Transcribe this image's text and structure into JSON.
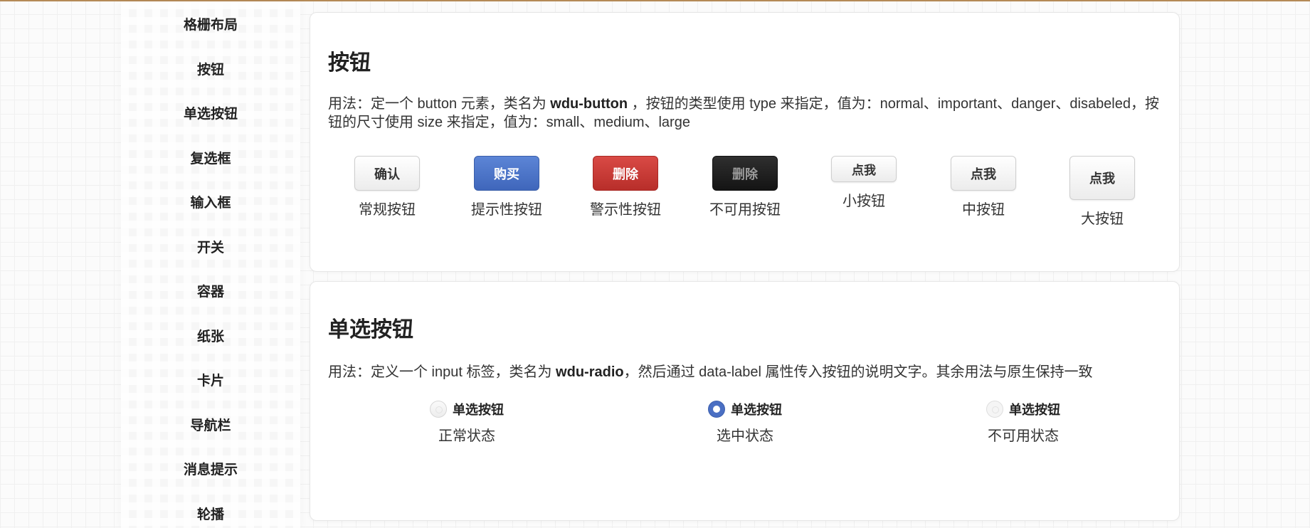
{
  "sidebar": {
    "items": [
      {
        "label": "格栅布局"
      },
      {
        "label": "按钮"
      },
      {
        "label": "单选按钮"
      },
      {
        "label": "复选框"
      },
      {
        "label": "输入框"
      },
      {
        "label": "开关"
      },
      {
        "label": "容器"
      },
      {
        "label": "纸张"
      },
      {
        "label": "卡片"
      },
      {
        "label": "导航栏"
      },
      {
        "label": "消息提示"
      },
      {
        "label": "轮播"
      }
    ]
  },
  "button_section": {
    "title": "按钮",
    "usage_prefix": "用法：定一个 button 元素，类名为 ",
    "usage_class": "wdu-button",
    "usage_suffix": " ，按钮的类型使用 type 来指定，值为：normal、important、danger、disabeled，按钮的尺寸使用 size 来指定，值为：small、medium、large",
    "demos": [
      {
        "button_text": "确认",
        "caption": "常规按钮"
      },
      {
        "button_text": "购买",
        "caption": "提示性按钮"
      },
      {
        "button_text": "删除",
        "caption": "警示性按钮"
      },
      {
        "button_text": "删除",
        "caption": "不可用按钮"
      },
      {
        "button_text": "点我",
        "caption": "小按钮"
      },
      {
        "button_text": "点我",
        "caption": "中按钮"
      },
      {
        "button_text": "点我",
        "caption": "大按钮"
      }
    ]
  },
  "radio_section": {
    "title": "单选按钮",
    "usage_prefix": "用法：定义一个 input 标签，类名为 ",
    "usage_class": "wdu-radio",
    "usage_suffix": "，然后通过 data-label 属性传入按钮的说明文字。其余用法与原生保持一致",
    "demos": [
      {
        "label": "单选按钮",
        "caption": "正常状态"
      },
      {
        "label": "单选按钮",
        "caption": "选中状态"
      },
      {
        "label": "单选按钮",
        "caption": "不可用状态"
      }
    ]
  },
  "colors": {
    "top_border": "#b58a57",
    "important": "#4a6fc3",
    "danger": "#c0392b",
    "disabled": "#1c1c1c"
  }
}
